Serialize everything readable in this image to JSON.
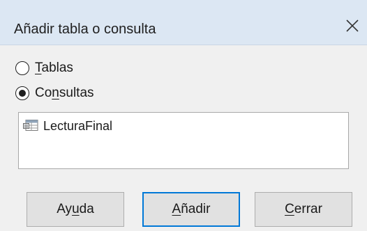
{
  "dialog": {
    "title": "Añadir tabla o consulta",
    "close_icon": "close-icon"
  },
  "options": [
    {
      "label_u": "T",
      "label_rest": "ablas",
      "selected": false
    },
    {
      "label_pre": "Co",
      "label_u": "n",
      "label_rest": "sultas",
      "selected": true
    }
  ],
  "list": {
    "items": [
      {
        "label": "LecturaFinal",
        "icon": "query-icon"
      }
    ]
  },
  "buttons": {
    "help": {
      "pre": "Ay",
      "u": "u",
      "post": "da"
    },
    "add": {
      "pre": "",
      "u": "A",
      "post": "ñadir"
    },
    "close": {
      "pre": "",
      "u": "C",
      "post": "errar"
    }
  },
  "colors": {
    "titlebar": "#dce7f3",
    "default_button_border": "#0078d7"
  }
}
